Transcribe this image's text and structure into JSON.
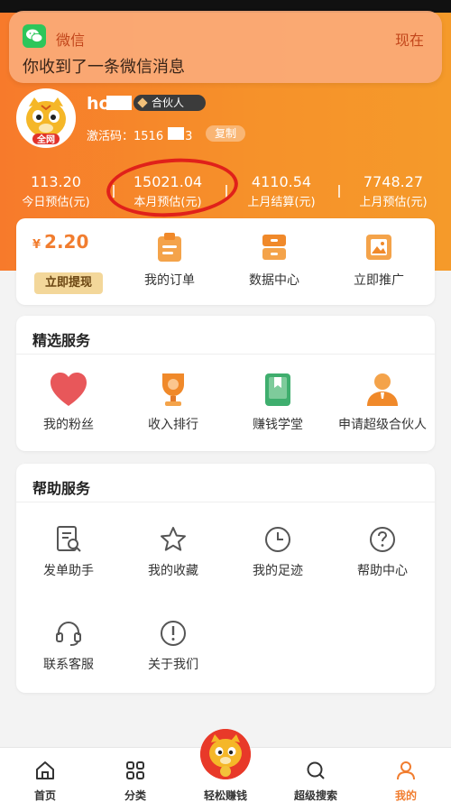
{
  "notification": {
    "app_name": "微信",
    "time": "现在",
    "message": "你收到了一条微信消息"
  },
  "profile": {
    "username": "ho",
    "badge": "合伙人",
    "activation_label": "激活码：1516",
    "activation_tail": "3",
    "copy_label": "复制",
    "avatar_tag": "全网"
  },
  "stats": [
    {
      "value": "113.20",
      "label": "今日预估(元)"
    },
    {
      "value": "15021.04",
      "label": "本月预估(元)"
    },
    {
      "value": "4110.54",
      "label": "上月结算(元)"
    },
    {
      "value": "7748.27",
      "label": "上月预估(元)"
    }
  ],
  "wallet": {
    "currency": "¥",
    "balance": "2.20",
    "withdraw_label": "立即提现",
    "items": [
      {
        "label": "我的订单",
        "icon": "clipboard-icon"
      },
      {
        "label": "数据中心",
        "icon": "cabinet-icon"
      },
      {
        "label": "立即推广",
        "icon": "image-icon"
      }
    ]
  },
  "featured": {
    "title": "精选服务",
    "items": [
      {
        "label": "我的粉丝",
        "icon": "heart-icon"
      },
      {
        "label": "收入排行",
        "icon": "trophy-icon"
      },
      {
        "label": "赚钱学堂",
        "icon": "book-icon"
      },
      {
        "label": "申请超级合伙人",
        "icon": "person-icon"
      }
    ]
  },
  "help": {
    "title": "帮助服务",
    "items": [
      {
        "label": "发单助手",
        "icon": "document-search-icon"
      },
      {
        "label": "我的收藏",
        "icon": "star-icon"
      },
      {
        "label": "我的足迹",
        "icon": "clock-icon"
      },
      {
        "label": "帮助中心",
        "icon": "question-icon"
      },
      {
        "label": "联系客服",
        "icon": "headset-icon"
      },
      {
        "label": "关于我们",
        "icon": "info-icon"
      }
    ]
  },
  "nav": [
    {
      "label": "首页",
      "icon": "home-icon"
    },
    {
      "label": "分类",
      "icon": "grid-icon"
    },
    {
      "label": "轻松赚钱",
      "icon": "mascot-icon"
    },
    {
      "label": "超级搜索",
      "icon": "search-icon"
    },
    {
      "label": "我的",
      "icon": "user-icon",
      "active": true
    }
  ],
  "colors": {
    "accent": "#f17d2f",
    "header_start": "#f77a2b",
    "header_end": "#f59a2a",
    "highlight": "#e0211a"
  }
}
